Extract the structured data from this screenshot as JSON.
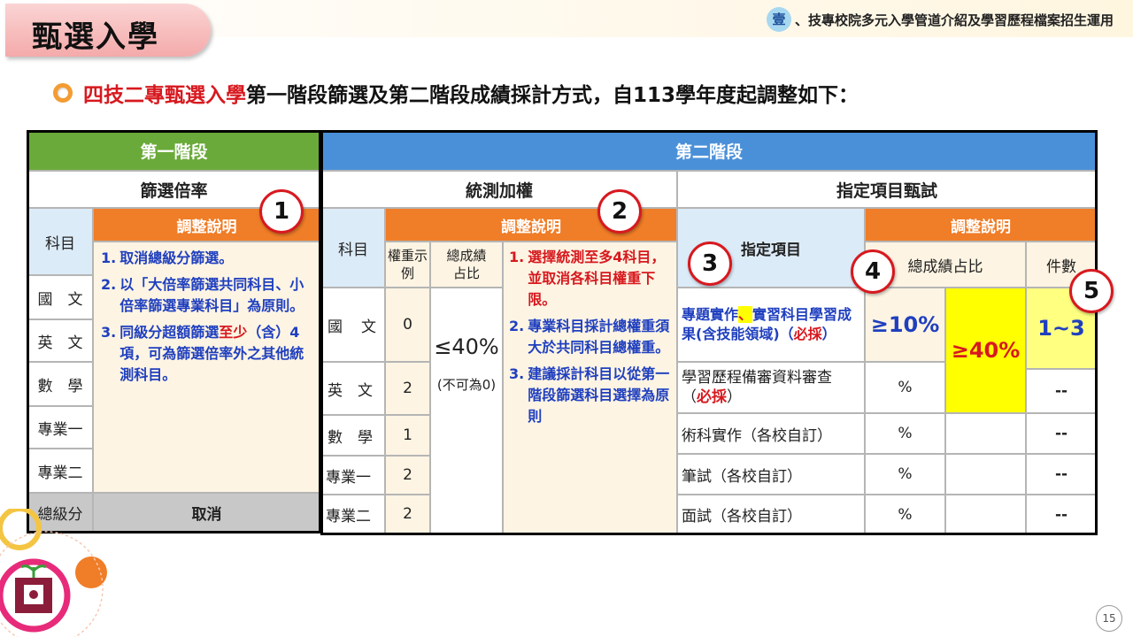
{
  "header": {
    "title": "甄選入學",
    "section_num": "壹",
    "section_title": "、技專校院多元入學管道介紹及學習歷程檔案招生運用"
  },
  "headline": {
    "highlight": "四技二專甄選入學",
    "rest": "第一階段篩選及第二階段成績採計方式，自113學年度起調整如下："
  },
  "stage1": {
    "head": "第一階段",
    "sub": "篩選倍率",
    "subject_label": "科目",
    "note_label": "調整說明",
    "subjects": [
      "國　文",
      "英　文",
      "數　學",
      "專業一",
      "專業二"
    ],
    "total_label": "總級分",
    "total_value": "取消",
    "notes": [
      {
        "n": "1.",
        "t": "取消總級分篩選。"
      },
      {
        "n": "2.",
        "t": "以「大倍率篩選共同科目、小倍率篩選專業科目」為原則。"
      },
      {
        "n": "3.",
        "t1": "同級分超額篩選",
        "t2": "至少",
        "t3": "（含）4項，可為篩選倍率外之其他統測科目。"
      }
    ]
  },
  "stage2": {
    "head": "第二階段",
    "test": {
      "head": "統測加權",
      "subject_label": "科目",
      "weight_label": "權重示例",
      "ratio_label": "總成績占比",
      "note_label": "調整說明",
      "rows": [
        {
          "subject": "國　文",
          "weight": "0"
        },
        {
          "subject": "英　文",
          "weight": "2"
        },
        {
          "subject": "數　學",
          "weight": "1"
        },
        {
          "subject": "專業一",
          "weight": "2"
        },
        {
          "subject": "專業二",
          "weight": "2"
        }
      ],
      "ratio_value": "≤40%",
      "ratio_note": "(不可為0)",
      "notes": [
        {
          "n": "1.",
          "t": "選擇統測至多4科目，並取消各科目權重下限。"
        },
        {
          "n": "2.",
          "t": "專業科目採計總權重須大於共同科目總權重。"
        },
        {
          "n": "3.",
          "t": "建議採計科目以從第一階段篩選科目選擇為原則"
        }
      ]
    },
    "exam": {
      "head": "指定項目甄試",
      "item_label": "指定項目",
      "note_label": "調整說明",
      "ratio_label": "總成績占比",
      "count_label": "件數",
      "rows": [
        {
          "a": "專題實作",
          "sep": "、",
          "b": "實習科目學習成果(含技能領域)（",
          "req": "必採",
          "end": "）",
          "ratio": "≥10%",
          "count": "1~3"
        },
        {
          "a": "學習歷程備審資料審查（",
          "req": "必採",
          "end": "）",
          "ratio": "%",
          "count": "--"
        },
        {
          "a": "術科實作（各校自訂）",
          "ratio": "%",
          "count": "--"
        },
        {
          "a": "筆試（各校自訂）",
          "ratio": "%",
          "count": "--"
        },
        {
          "a": "面試（各校自訂）",
          "ratio": "%",
          "count": "--"
        }
      ],
      "combined_ratio": "≥40%"
    }
  },
  "badges": [
    "1",
    "2",
    "3",
    "4",
    "5"
  ],
  "page_number": "15"
}
